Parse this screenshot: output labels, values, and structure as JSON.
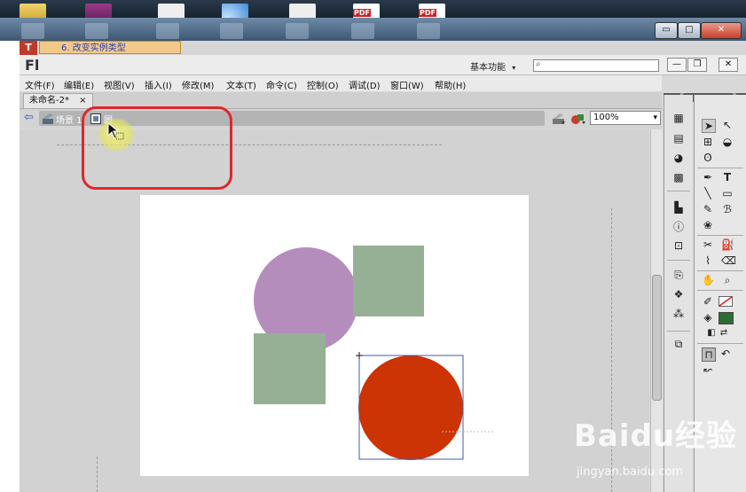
{
  "desktop": {
    "icons": [
      "folder-icon",
      "archive-icon",
      "document-icon",
      "rss-icon",
      "document-icon",
      "pdf-icon",
      "pdf-icon"
    ],
    "pdf_label": "PDF"
  },
  "window": {
    "minimize": "▭",
    "maximize": "□",
    "close": "✕"
  },
  "side_tab": {
    "mark": "T",
    "title": "6. 改变实例类型"
  },
  "app": {
    "logo": "Fl",
    "workspace": "基本功能",
    "workspace_arrow": "▾",
    "search_icon": "⌕",
    "search_placeholder": "",
    "controls": {
      "minimize": "—",
      "restore": "❐",
      "close": "✕"
    }
  },
  "menus": [
    "文件(F)",
    "编辑(E)",
    "视图(V)",
    "插入(I)",
    "修改(M)",
    "文本(T)",
    "命令(C)",
    "控制(O)",
    "调试(D)",
    "窗口(W)",
    "帮助(H)"
  ],
  "document_tab": {
    "name": "未命名-2*",
    "close": "×"
  },
  "edit_bar": {
    "back": "⇦",
    "scene": "场景 1",
    "symbol": "圆",
    "zoom": "100%",
    "zoom_arrow": "▾"
  },
  "panel_header": {
    "collapse_left": "«",
    "collapse_right": "»"
  },
  "colors": {
    "purple_circle": "#b48dbd",
    "green_square": "#96b095",
    "red_circle": "#cc3305",
    "fill_swatch": "#2e6b35",
    "highlight": "#e0272b"
  },
  "watermark": {
    "logo": "Baidu经验",
    "url": "jingyan.baidu.com"
  },
  "annotation": "highlighted symbol breadcrumb"
}
